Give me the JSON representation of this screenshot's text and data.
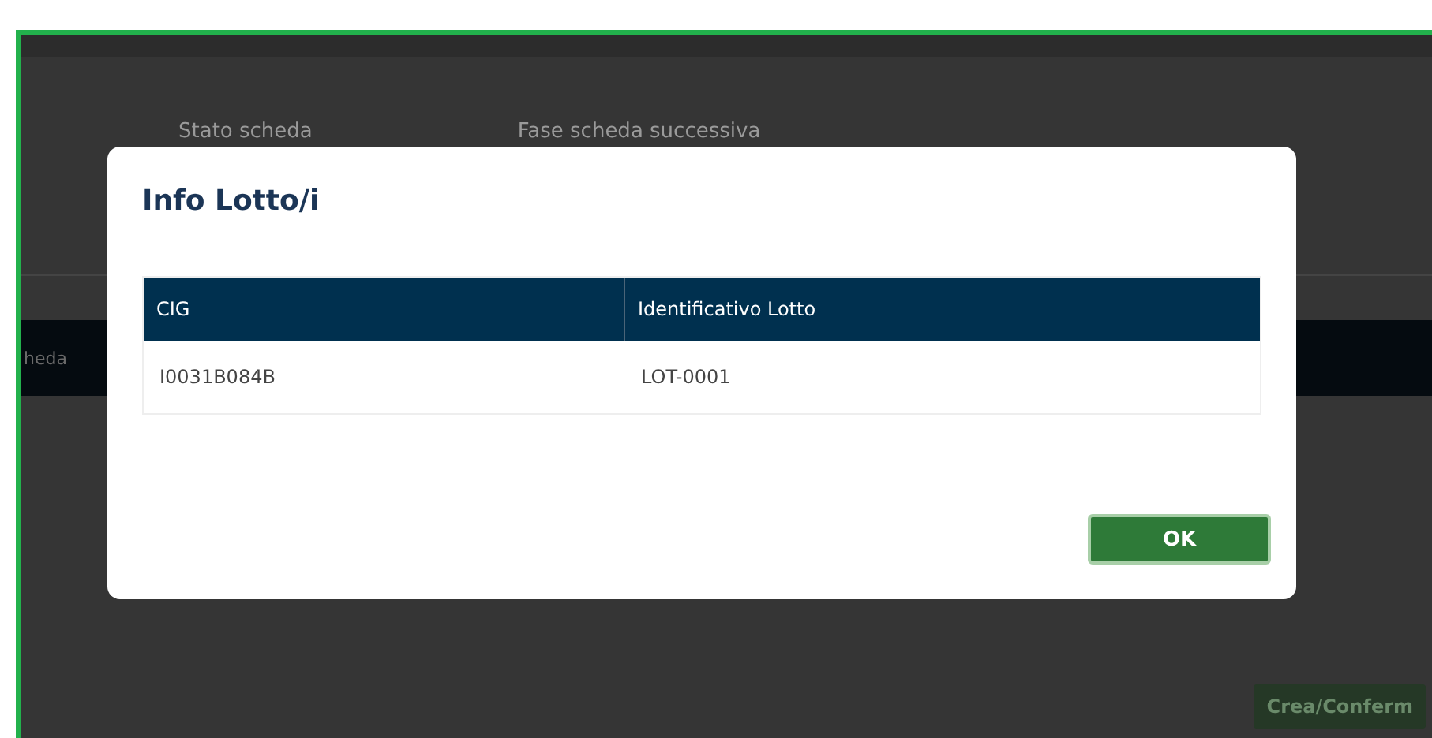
{
  "background": {
    "fields": [
      "Stato scheda",
      "Fase scheda successiva"
    ],
    "table_header": {
      "column_1": "heda"
    },
    "button": "Crea/Conferm"
  },
  "dialog": {
    "title": "Info Lotto/i",
    "table": {
      "columns": [
        "CIG",
        "Identificativo Lotto"
      ],
      "rows": [
        [
          "I0031B084B",
          "LOT-0001"
        ]
      ]
    },
    "button": "OK"
  }
}
